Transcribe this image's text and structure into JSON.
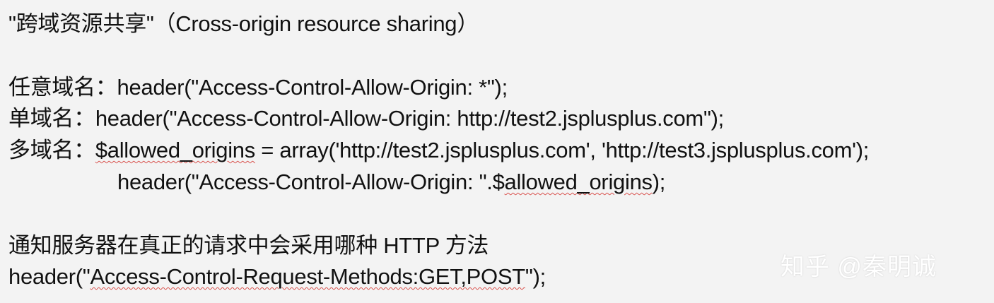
{
  "title_line": "\"跨域资源共享\"（Cross-origin resource sharing）",
  "any_domain": {
    "label": "任意域名：",
    "code": "header(\"Access-Control-Allow-Origin: *\");"
  },
  "single_domain": {
    "label": "单域名：",
    "code": "header(\"Access-Control-Allow-Origin: http://test2.jsplusplus.com\");"
  },
  "multi_domain": {
    "label": "多域名：",
    "code1_var": "$allowed_origins",
    "code1_rest": " = array('http://test2.jsplusplus.com', 'http://test3.jsplusplus.com');",
    "code2_start": "header(\"Access-Control-Allow-Origin: \".$",
    "code2_var": "allowed_origins",
    "code2_end": ");"
  },
  "method_notice": "通知服务器在真正的请求中会采用哪种 HTTP 方法",
  "method_header": {
    "start": "header(\"",
    "value": "Access-Control-Request-Methods:GET,POST",
    "end": "\");"
  },
  "watermark": "知乎 @秦明诚"
}
